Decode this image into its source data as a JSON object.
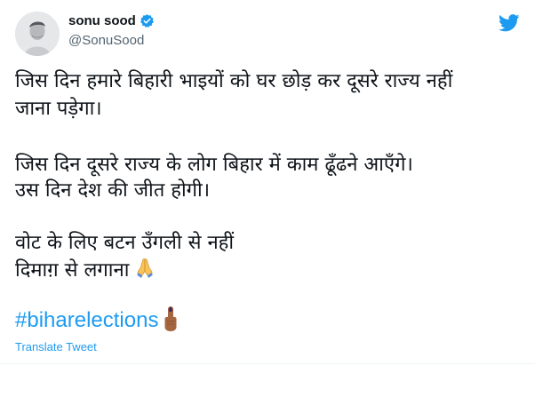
{
  "author": {
    "name": "sonu sood",
    "handle": "@SonuSood",
    "verified": true
  },
  "tweet": {
    "lines": [
      "जिस दिन हमारे बिहारी भाइयों को घर छोड़ कर दूसरे राज्य नहीं",
      "जाना पड़ेगा।",
      "जिस दिन दूसरे राज्य के लोग बिहार में काम ढूँढने आएँगे।",
      "उस दिन देश की जीत होगी।",
      "वोट के लिए बटन उँगली से नहीं",
      "दिमाग़ से लगाना"
    ],
    "hashtag": "#biharelections",
    "translate_label": "Translate Tweet"
  },
  "icons": {
    "logo": "twitter-bird-icon",
    "verified": "verified-badge-icon",
    "pray": "folded-hands-emoji",
    "finger": "inked-finger-emoji"
  },
  "colors": {
    "accent": "#1d9bf0",
    "text": "#0f1419",
    "muted": "#536471"
  }
}
